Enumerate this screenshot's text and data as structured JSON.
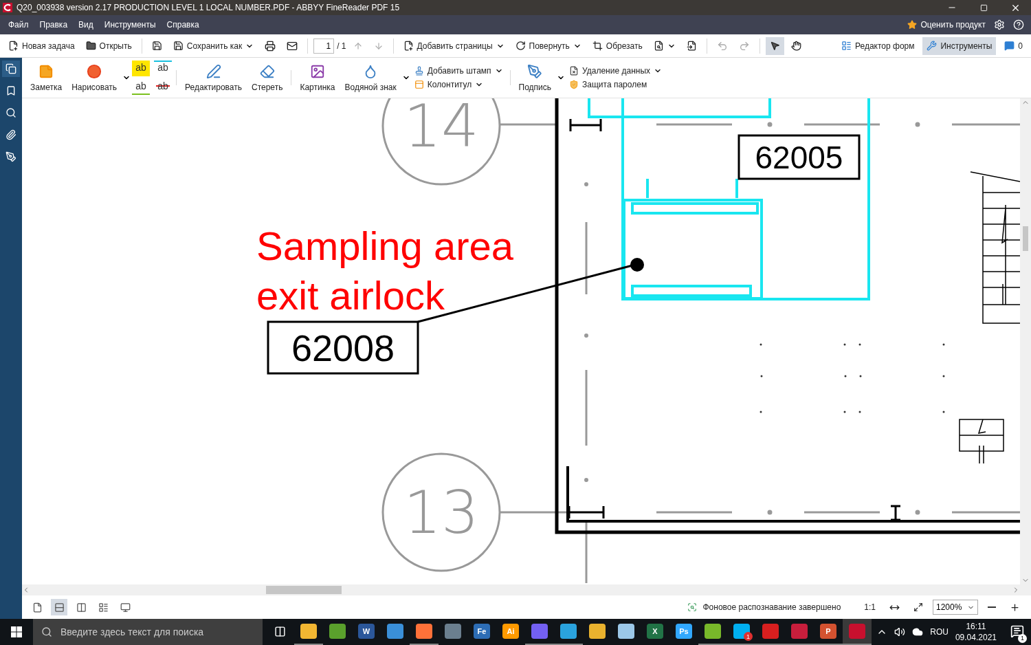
{
  "window": {
    "title": "Q20_003938 version 2.17 PRODUCTION LEVEL 1 LOCAL NUMBER.PDF - ABBYY FineReader PDF 15"
  },
  "menu": {
    "items": [
      "Файл",
      "Правка",
      "Вид",
      "Инструменты",
      "Справка"
    ],
    "rate": "Оценить продукт"
  },
  "toolbar": {
    "new_task": "Новая задача",
    "open": "Открыть",
    "save_as": "Сохранить как",
    "page": "1",
    "page_total": "/ 1",
    "add_pages": "Добавить страницы",
    "rotate": "Повернуть",
    "crop": "Обрезать",
    "select_tool_selected": true,
    "hand_tool_selected": false,
    "modes": [
      {
        "label": "Редактор форм",
        "kind": "forms",
        "selected": false
      },
      {
        "label": "Инструменты",
        "kind": "tools",
        "selected": true
      }
    ],
    "comments": "0"
  },
  "sidebar": {
    "items": [
      {
        "kind": "pages",
        "selected": true
      },
      {
        "kind": "bookmarks",
        "selected": false
      },
      {
        "kind": "search",
        "selected": false
      },
      {
        "kind": "attachments",
        "selected": false
      },
      {
        "kind": "signatures",
        "selected": false
      }
    ]
  },
  "ribbon": {
    "note": "Заметка",
    "draw": "Нарисовать",
    "markup": [
      {
        "glyph": "ab",
        "kind": "highlight"
      },
      {
        "glyph": "ab",
        "kind": "insert"
      },
      {
        "glyph": "ab",
        "kind": "underline"
      },
      {
        "glyph": "ab",
        "kind": "strike"
      }
    ],
    "edit": "Редактировать",
    "erase": "Стереть",
    "image": "Картинка",
    "watermark": "Водяной знак",
    "stamp": "Добавить штамп",
    "header_footer": "Колонтитул",
    "signature": "Подпись",
    "redact": "Удаление данных",
    "password": "Защита паролем"
  },
  "document": {
    "grid_labels": [
      "14",
      "13"
    ],
    "rooms": [
      {
        "number": "62005"
      },
      {
        "number": "62008"
      }
    ],
    "annotation": {
      "lines": [
        "Sampling area",
        "exit airlock"
      ]
    }
  },
  "status_bar": {
    "view_modes": [
      {
        "kind": "single",
        "selected": false
      },
      {
        "kind": "scroll",
        "selected": true
      },
      {
        "kind": "two",
        "selected": false
      },
      {
        "kind": "two-scroll",
        "selected": false
      },
      {
        "kind": "present",
        "selected": false
      }
    ],
    "status": "Фоновое распознавание завершено",
    "actual": "1:1",
    "zoom": "1200%"
  },
  "taskbar": {
    "search_placeholder": "Введите здесь текст для поиска",
    "apps": [
      {
        "kind": "explorer",
        "running": true,
        "active": false
      },
      {
        "kind": "corel",
        "running": false,
        "active": false
      },
      {
        "kind": "word",
        "glyph": "W",
        "running": false,
        "active": false
      },
      {
        "kind": "computer",
        "running": false,
        "active": false
      },
      {
        "kind": "firefox",
        "running": true,
        "active": false
      },
      {
        "kind": "calc",
        "running": false,
        "active": false
      },
      {
        "kind": "fe",
        "glyph": "Fe",
        "running": false,
        "active": false
      },
      {
        "kind": "illustrator",
        "glyph": "Ai",
        "running": false,
        "active": false
      },
      {
        "kind": "viber",
        "running": true,
        "active": false
      },
      {
        "kind": "telegram",
        "running": true,
        "active": false
      },
      {
        "kind": "chrome",
        "running": false,
        "active": false
      },
      {
        "kind": "notepad",
        "running": false,
        "active": false
      },
      {
        "kind": "excel",
        "glyph": "X",
        "running": false,
        "active": false
      },
      {
        "kind": "photoshop",
        "glyph": "Ps",
        "running": false,
        "active": false
      },
      {
        "kind": "torrent",
        "running": true,
        "active": false
      },
      {
        "kind": "skype",
        "running": true,
        "active": false,
        "badge": "1"
      },
      {
        "kind": "acrobat",
        "running": true,
        "active": false
      },
      {
        "kind": "tool",
        "running": true,
        "active": false
      },
      {
        "kind": "powerpoint",
        "glyph": "P",
        "running": true,
        "active": false
      },
      {
        "kind": "finereader",
        "running": true,
        "active": true
      }
    ],
    "lang": "ROU",
    "time": "16:11",
    "date": "09.04.2021",
    "notifications": "1"
  }
}
